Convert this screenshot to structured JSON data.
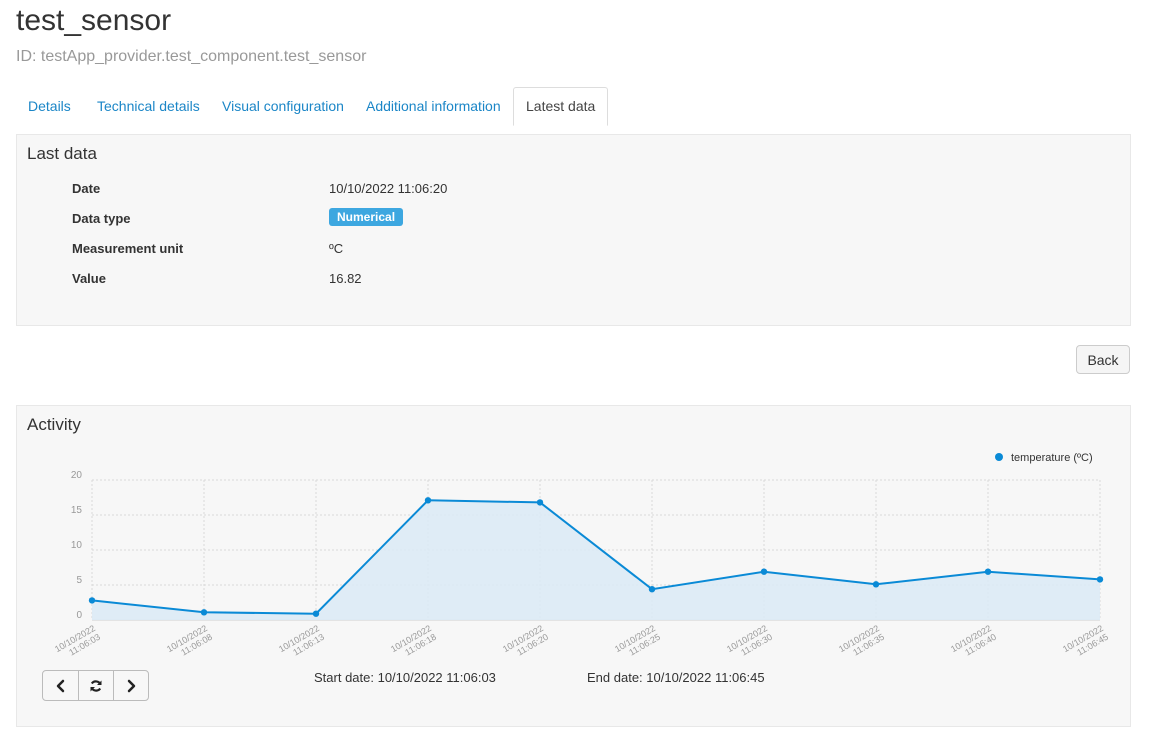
{
  "header": {
    "title": "test_sensor",
    "subtitle": "ID: testApp_provider.test_component.test_sensor"
  },
  "tabs": [
    {
      "label": "Details"
    },
    {
      "label": "Technical details"
    },
    {
      "label": "Visual configuration"
    },
    {
      "label": "Additional information"
    },
    {
      "label": "Latest data",
      "active": true
    }
  ],
  "last_data": {
    "title": "Last data",
    "rows": [
      {
        "label": "Date",
        "value": "10/10/2022 11:06:20"
      },
      {
        "label": "Data type",
        "value": "Numerical"
      },
      {
        "label": "Measurement unit",
        "value": "ºC"
      },
      {
        "label": "Value",
        "value": "16.82"
      }
    ]
  },
  "back_button": "Back",
  "activity": {
    "title": "Activity",
    "start_date": "Start date: 10/10/2022 11:06:03",
    "end_date": "End date: 10/10/2022 11:06:45"
  },
  "colors": {
    "accent": "#1b86c7",
    "badge": "#3da7e0",
    "series": "#0a8ad6",
    "fill": "#dceaf5"
  },
  "chart_data": {
    "type": "area",
    "categories": [
      [
        "10/10/2022",
        "11:06:03"
      ],
      [
        "10/10/2022",
        "11:06:08"
      ],
      [
        "10/10/2022",
        "11:06:13"
      ],
      [
        "10/10/2022",
        "11:06:18"
      ],
      [
        "10/10/2022",
        "11:06:20"
      ],
      [
        "10/10/2022",
        "11:06:25"
      ],
      [
        "10/10/2022",
        "11:06:30"
      ],
      [
        "10/10/2022",
        "11:06:35"
      ],
      [
        "10/10/2022",
        "11:06:40"
      ],
      [
        "10/10/2022",
        "11:06:45"
      ]
    ],
    "series": [
      {
        "name": "temperature (ºC)",
        "values": [
          2.8,
          1.1,
          0.9,
          17.1,
          16.8,
          4.4,
          6.9,
          5.1,
          6.9,
          5.8
        ]
      }
    ],
    "yticks": [
      0,
      5,
      10,
      15,
      20
    ],
    "ylim": [
      0,
      20
    ],
    "grid": true,
    "legend": "top-right"
  }
}
